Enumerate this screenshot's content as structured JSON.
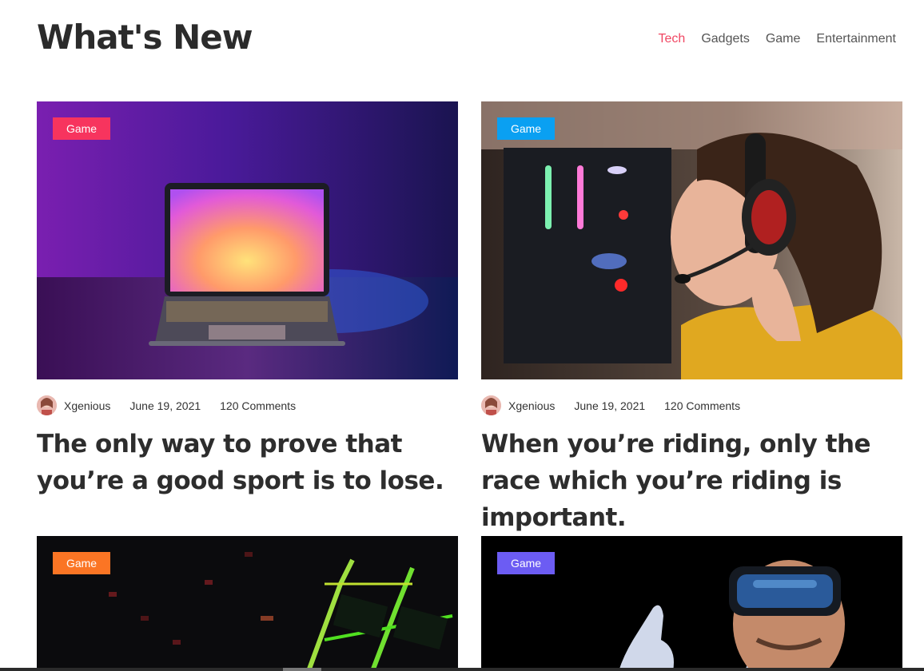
{
  "header": {
    "title": "What's New",
    "nav": [
      {
        "label": "Tech",
        "active": true
      },
      {
        "label": "Gadgets",
        "active": false
      },
      {
        "label": "Game",
        "active": false
      },
      {
        "label": "Entertainment",
        "active": false
      }
    ]
  },
  "posts": [
    {
      "badge": "Game",
      "badge_color": "#f7345e",
      "author": "Xgenious",
      "date": "June 19, 2021",
      "comments": "120 Comments",
      "title": "The only way to prove that you’re a good sport is to lose.",
      "image": "laptop-neon-image"
    },
    {
      "badge": "Game",
      "badge_color": "#0aa0f2",
      "author": "Xgenious",
      "date": "June 19, 2021",
      "comments": "120 Comments",
      "title": "When you’re riding, only the race which you’re riding is important.",
      "image": "gamer-headset-image"
    },
    {
      "badge": "Game",
      "badge_color": "#fb7524",
      "image": "keyboard-rgb-image"
    },
    {
      "badge": "Game",
      "badge_color": "#6c5cf3",
      "image": "vr-headset-image"
    }
  ],
  "colors": {
    "accent": "#f04763",
    "text": "#2b2b2b"
  }
}
